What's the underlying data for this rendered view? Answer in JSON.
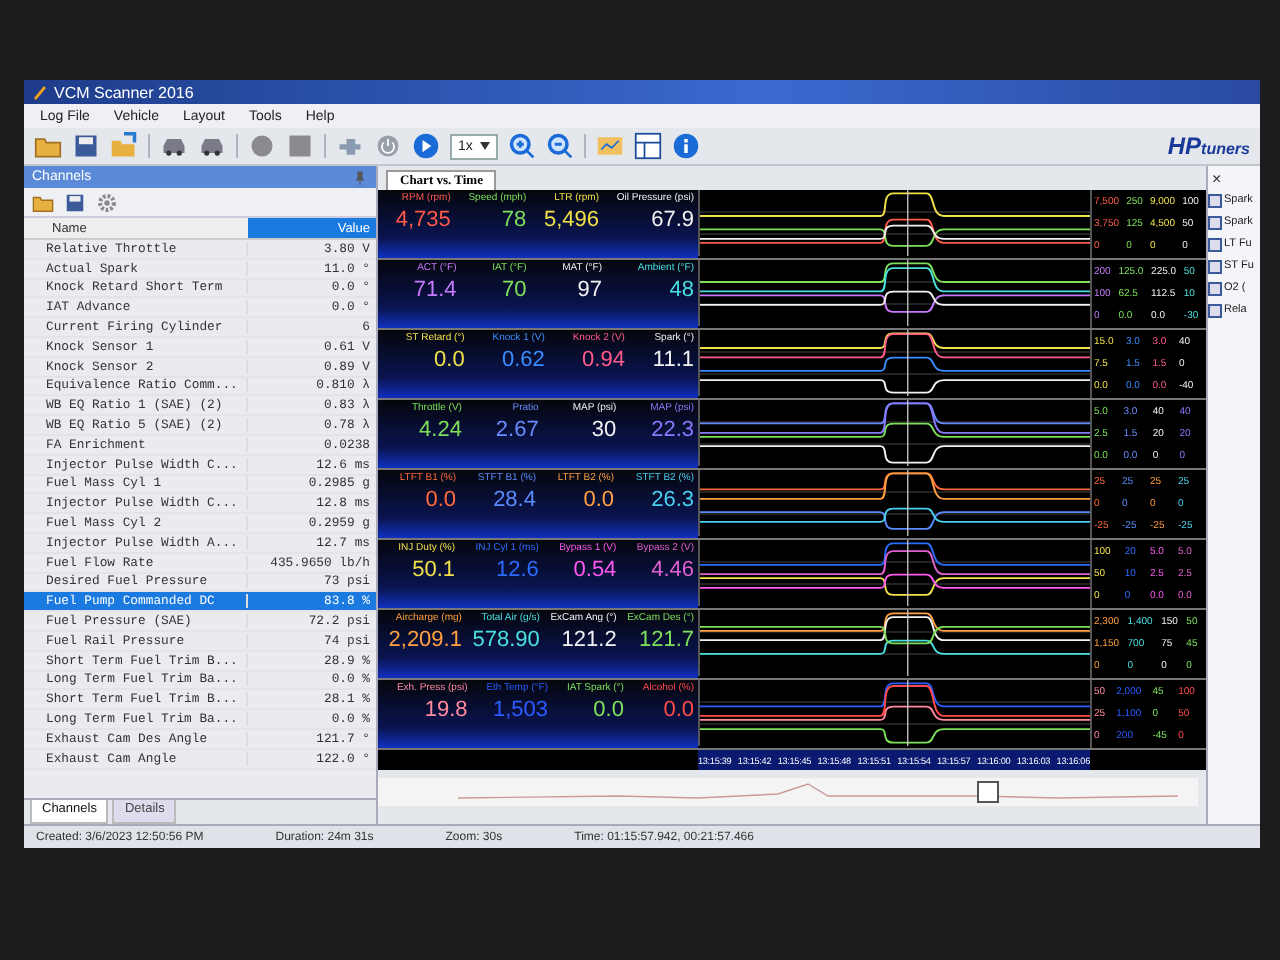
{
  "window": {
    "title": "VCM Scanner 2016"
  },
  "menu": [
    "Log File",
    "Vehicle",
    "Layout",
    "Tools",
    "Help"
  ],
  "toolbar": {
    "speed": "1x"
  },
  "logo": {
    "text": "HP",
    "subtext": "tuners"
  },
  "channels_panel": {
    "title": "Channels",
    "columns": [
      "Name",
      "Value"
    ],
    "rows": [
      {
        "name": "Relative Throttle",
        "value": "3.80 V",
        "selected": false
      },
      {
        "name": "Actual Spark",
        "value": "11.0 °",
        "selected": false
      },
      {
        "name": "Knock Retard Short Term",
        "value": "0.0 °",
        "selected": false
      },
      {
        "name": "IAT Advance",
        "value": "0.0 °",
        "selected": false
      },
      {
        "name": "Current Firing Cylinder",
        "value": "6",
        "selected": false
      },
      {
        "name": "Knock Sensor 1",
        "value": "0.61 V",
        "selected": false
      },
      {
        "name": "Knock Sensor 2",
        "value": "0.89 V",
        "selected": false
      },
      {
        "name": "Equivalence Ratio Comm...",
        "value": "0.810 λ",
        "selected": false
      },
      {
        "name": "WB EQ Ratio 1 (SAE) (2)",
        "value": "0.83 λ",
        "selected": false
      },
      {
        "name": "WB EQ Ratio 5 (SAE) (2)",
        "value": "0.78 λ",
        "selected": false
      },
      {
        "name": "FA Enrichment",
        "value": "0.0238",
        "selected": false
      },
      {
        "name": "Injector Pulse Width C...",
        "value": "12.6 ms",
        "selected": false
      },
      {
        "name": "Fuel Mass Cyl 1",
        "value": "0.2985 g",
        "selected": false
      },
      {
        "name": "Injector Pulse Width C...",
        "value": "12.8 ms",
        "selected": false
      },
      {
        "name": "Fuel Mass Cyl 2",
        "value": "0.2959 g",
        "selected": false
      },
      {
        "name": "Injector Pulse Width A...",
        "value": "12.7 ms",
        "selected": false
      },
      {
        "name": "Fuel Flow Rate",
        "value": "435.9650 lb/h",
        "selected": false
      },
      {
        "name": "Desired Fuel Pressure",
        "value": "73 psi",
        "selected": false
      },
      {
        "name": "Fuel Pump Commanded DC",
        "value": "83.8 %",
        "selected": true
      },
      {
        "name": "Fuel Pressure (SAE)",
        "value": "72.2 psi",
        "selected": false
      },
      {
        "name": "Fuel Rail Pressure",
        "value": "74 psi",
        "selected": false
      },
      {
        "name": "Short Term Fuel Trim B...",
        "value": "28.9 %",
        "selected": false
      },
      {
        "name": "Long Term Fuel Trim Ba...",
        "value": "0.0 %",
        "selected": false
      },
      {
        "name": "Short Term Fuel Trim B...",
        "value": "28.1 %",
        "selected": false
      },
      {
        "name": "Long Term Fuel Trim Ba...",
        "value": "0.0 %",
        "selected": false
      },
      {
        "name": "Exhaust Cam Des Angle",
        "value": "121.7 °",
        "selected": false
      },
      {
        "name": "Exhaust Cam Angle",
        "value": "122.0 °",
        "selected": false
      }
    ],
    "tabs": [
      {
        "label": "Channels",
        "selected": true
      },
      {
        "label": "Details",
        "selected": false
      }
    ]
  },
  "chart_tab": {
    "label": "Chart vs. Time"
  },
  "strips": [
    {
      "gauges": [
        {
          "label": "RPM (rpm)",
          "value": "4,735",
          "color": "#ff5a4a",
          "scale": [
            "7,500",
            "3,750",
            "0"
          ]
        },
        {
          "label": "Speed (mph)",
          "value": "78",
          "color": "#7de05a",
          "scale": [
            "250",
            "125",
            "0"
          ]
        },
        {
          "label": "LTR (rpm)",
          "value": "5,496",
          "color": "#f0e04a",
          "scale": [
            "9,000",
            "4,500",
            "0"
          ]
        },
        {
          "label": "Oil Pressure (psi)",
          "value": "67.9",
          "color": "#f2f2f2",
          "scale": [
            "100",
            "50",
            "0"
          ]
        }
      ]
    },
    {
      "gauges": [
        {
          "label": "ACT (°F)",
          "value": "71.4",
          "color": "#c87aff",
          "scale": [
            "200",
            "100",
            "0"
          ]
        },
        {
          "label": "IAT (°F)",
          "value": "70",
          "color": "#7de05a",
          "scale": [
            "125.0",
            "62.5",
            "0.0"
          ]
        },
        {
          "label": "MAT (°F)",
          "value": "97",
          "color": "#f2f2f2",
          "scale": [
            "225.0",
            "112.5",
            "0.0"
          ]
        },
        {
          "label": "Ambient (°F)",
          "value": "48",
          "color": "#4ae0e0",
          "scale": [
            "50",
            "10",
            "-30"
          ]
        }
      ]
    },
    {
      "gauges": [
        {
          "label": "ST Retard (°)",
          "value": "0.0",
          "color": "#f0e04a",
          "scale": [
            "15.0",
            "7.5",
            "0.0"
          ]
        },
        {
          "label": "Knock 1 (V)",
          "value": "0.62",
          "color": "#3a8cff",
          "scale": [
            "3.0",
            "1.5",
            "0.0"
          ]
        },
        {
          "label": "Knock 2 (V)",
          "value": "0.94",
          "color": "#ff5a8a",
          "scale": [
            "3.0",
            "1.5",
            "0.0"
          ]
        },
        {
          "label": "Spark (°)",
          "value": "11.1",
          "color": "#f2f2f2",
          "scale": [
            "40",
            "0",
            "-40"
          ]
        }
      ]
    },
    {
      "gauges": [
        {
          "label": "Throttle (V)",
          "value": "4.24",
          "color": "#7de05a",
          "scale": [
            "5.0",
            "2.5",
            "0.0"
          ]
        },
        {
          "label": "Pratio",
          "value": "2.67",
          "color": "#6a8cff",
          "scale": [
            "3.0",
            "1.5",
            "0.0"
          ]
        },
        {
          "label": "MAP (psi)",
          "value": "30",
          "color": "#f2f2f2",
          "scale": [
            "40",
            "20",
            "0"
          ]
        },
        {
          "label": "MAP (psi)",
          "value": "22.3",
          "color": "#8a7aff",
          "scale": [
            "40",
            "20",
            "0"
          ]
        }
      ]
    },
    {
      "gauges": [
        {
          "label": "LTFT B1 (%)",
          "value": "0.0",
          "color": "#ff6a3a",
          "scale": [
            "25",
            "0",
            "-25"
          ]
        },
        {
          "label": "STFT B1 (%)",
          "value": "28.4",
          "color": "#5a8cff",
          "scale": [
            "25",
            "0",
            "-25"
          ]
        },
        {
          "label": "LTFT B2 (%)",
          "value": "0.0",
          "color": "#ffa040",
          "scale": [
            "25",
            "0",
            "-25"
          ]
        },
        {
          "label": "STFT B2 (%)",
          "value": "26.3",
          "color": "#4ad0f0",
          "scale": [
            "25",
            "0",
            "-25"
          ]
        }
      ]
    },
    {
      "gauges": [
        {
          "label": "INJ Duty (%)",
          "value": "50.1",
          "color": "#f0e04a",
          "scale": [
            "100",
            "50",
            "0"
          ]
        },
        {
          "label": "INJ Cyl 1 (ms)",
          "value": "12.6",
          "color": "#2a6cff",
          "scale": [
            "20",
            "10",
            "0"
          ]
        },
        {
          "label": "Bypass 1 (V)",
          "value": "0.54",
          "color": "#ff5af0",
          "scale": [
            "5.0",
            "2.5",
            "0.0"
          ]
        },
        {
          "label": "Bypass 2 (V)",
          "value": "4.46",
          "color": "#e060d0",
          "scale": [
            "5.0",
            "2.5",
            "0.0"
          ]
        }
      ]
    },
    {
      "gauges": [
        {
          "label": "Aircharge (mg)",
          "value": "2,209.1",
          "color": "#ffa040",
          "scale": [
            "2,300",
            "1,150",
            "0"
          ]
        },
        {
          "label": "Total Air (g/s)",
          "value": "578.90",
          "color": "#4ae0e0",
          "scale": [
            "1,400",
            "700",
            "0"
          ]
        },
        {
          "label": "ExCam Ang (°)",
          "value": "121.2",
          "color": "#f2f2f2",
          "scale": [
            "150",
            "75",
            "0"
          ]
        },
        {
          "label": "ExCam Des (°)",
          "value": "121.7",
          "color": "#7de05a",
          "scale": [
            "50",
            "45",
            "0"
          ]
        }
      ]
    },
    {
      "gauges": [
        {
          "label": "Exh. Press (psi)",
          "value": "19.8",
          "color": "#ff8aa0",
          "scale": [
            "50",
            "25",
            "0"
          ]
        },
        {
          "label": "Eth Temp (°F)",
          "value": "1,503",
          "color": "#2a5cff",
          "scale": [
            "2,000",
            "1,100",
            "200"
          ]
        },
        {
          "label": "IAT Spark (°)",
          "value": "0.0",
          "color": "#7de05a",
          "scale": [
            "45",
            "0",
            "-45"
          ]
        },
        {
          "label": "Alcohol (%)",
          "value": "0.0",
          "color": "#ff4a4a",
          "scale": [
            "100",
            "50",
            "0"
          ]
        }
      ]
    }
  ],
  "time_axis": [
    "13:15:39",
    "13:15:42",
    "13:15:45",
    "13:15:48",
    "13:15:51",
    "13:15:54",
    "13:15:57",
    "13:16:00",
    "13:16:03",
    "13:16:06"
  ],
  "side_panel": {
    "close": "×",
    "items": [
      "Spark",
      "Spark",
      "LT Fu",
      "ST Fu",
      "O2 (",
      "Rela"
    ]
  },
  "status_bar": {
    "created": "Created: 3/6/2023 12:50:56 PM",
    "duration": "Duration: 24m 31s",
    "zoom": "Zoom: 30s",
    "time": "Time: 01:15:57.942, 00:21:57.466"
  }
}
